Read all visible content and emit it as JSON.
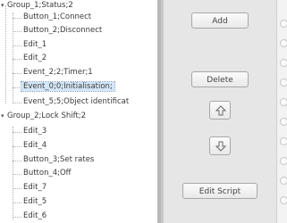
{
  "tree": {
    "groups": [
      {
        "label": "Group_1;Status;2",
        "children": [
          {
            "label": "Button_1;Connect"
          },
          {
            "label": "Button_2;Disconnect"
          },
          {
            "label": "Edit_1"
          },
          {
            "label": "Edit_2"
          },
          {
            "label": "Event_2;2;Timer;1"
          },
          {
            "label": "Event_0;0;Initialisation;",
            "selected": true
          },
          {
            "label": "Event_5;5;Object identificat"
          }
        ]
      },
      {
        "label": "Group_2;Lock Shift;2",
        "children": [
          {
            "label": "Edit_3"
          },
          {
            "label": "Edit_4"
          },
          {
            "label": "Button_3;Set rates"
          },
          {
            "label": "Button_4;Off"
          },
          {
            "label": "Edit_7"
          },
          {
            "label": "Edit_5"
          },
          {
            "label": "Edit_6"
          }
        ]
      }
    ]
  },
  "actions": {
    "add_label": "Add",
    "delete_label": "Delete",
    "edit_script_label": "Edit Script",
    "move_up_icon": "arrow-up-icon",
    "move_down_icon": "arrow-down-icon"
  },
  "colors": {
    "selection": "#d5e7f8",
    "panel": "#e6e6e6"
  }
}
